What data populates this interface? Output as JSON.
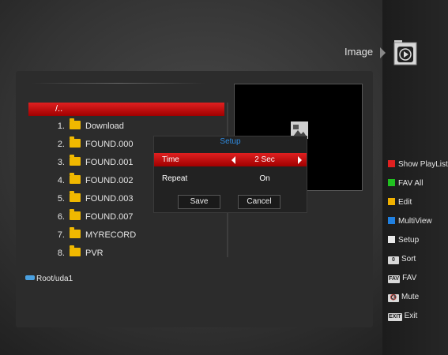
{
  "header": {
    "title": "Image",
    "icon": "image-player-icon"
  },
  "file_list": {
    "parent_label": "/..",
    "items": [
      {
        "num": "1.",
        "name": "Download"
      },
      {
        "num": "2.",
        "name": "FOUND.000"
      },
      {
        "num": "3.",
        "name": "FOUND.001"
      },
      {
        "num": "4.",
        "name": "FOUND.002"
      },
      {
        "num": "5.",
        "name": "FOUND.003"
      },
      {
        "num": "6.",
        "name": "FOUND.007"
      },
      {
        "num": "7.",
        "name": "MYRECORD"
      },
      {
        "num": "8.",
        "name": "PVR"
      }
    ],
    "path": "Root/uda1"
  },
  "setup_dialog": {
    "title": "Setup",
    "time_label": "Time",
    "time_value": "2 Sec",
    "repeat_label": "Repeat",
    "repeat_value": "On",
    "save_label": "Save",
    "cancel_label": "Cancel"
  },
  "legend": {
    "show_playlist": {
      "label": "Show PlayList",
      "color": "#e02020"
    },
    "fav_all": {
      "label": "FAV All",
      "color": "#20c020"
    },
    "edit": {
      "label": "Edit",
      "color": "#f0b000"
    },
    "multiview": {
      "label": "MultiView",
      "color": "#2080e0"
    },
    "setup": {
      "label": "Setup",
      "color": "#e8e8e8"
    },
    "sort": {
      "key": "0",
      "label": "Sort"
    },
    "fav": {
      "key": "FAV",
      "label": "FAV"
    },
    "mute": {
      "key": "🔇",
      "label": "Mute"
    },
    "exit": {
      "key": "EXIT",
      "label": "Exit"
    }
  },
  "colors": {
    "accent_red": "#e02020",
    "dialog_title": "#2f8be0",
    "folder": "#f0b800"
  }
}
